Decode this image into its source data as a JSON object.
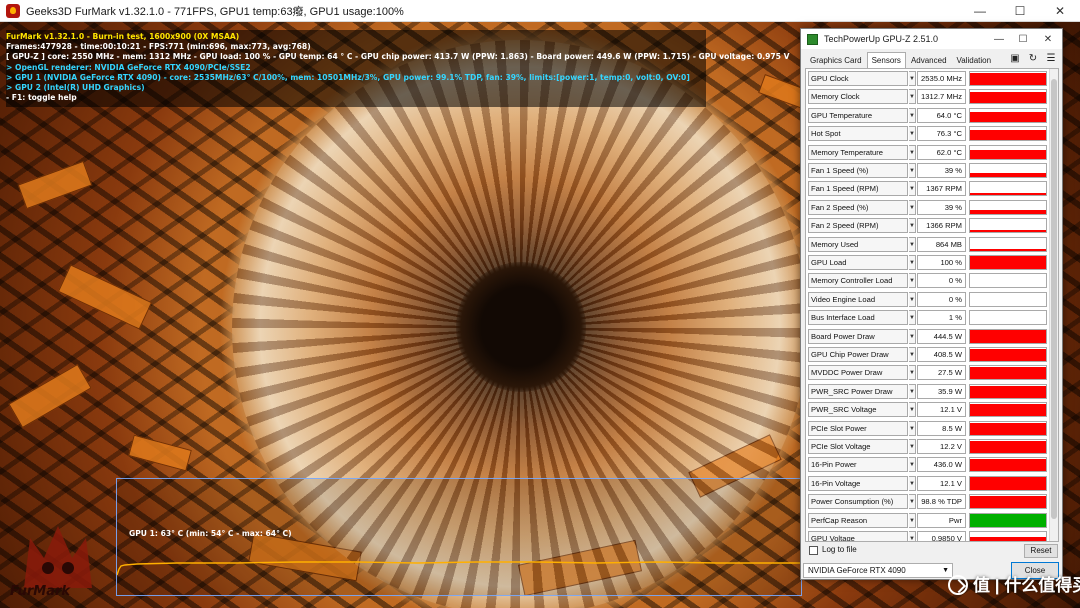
{
  "furmark_window": {
    "title": "Geeks3D FurMark v1.32.1.0 - 771FPS, GPU1 temp:63癈, GPU1 usage:100%",
    "controls": {
      "minimize": "—",
      "maximize": "☐",
      "close": "✕"
    },
    "overlay_lines": [
      {
        "text": "FurMark v1.32.1.0 - Burn-in test, 1600x900 (0X MSAA)",
        "color": "#ffe600"
      },
      {
        "text": "Frames:477928 - time:00:10:21 - FPS:771 (min:696, max:773, avg:768)",
        "color": "#ffffff"
      },
      {
        "text": "[ GPU-Z ] core: 2550 MHz - mem: 1312 MHz - GPU load: 100 % - GPU temp: 64 ° C - GPU chip power: 413.7 W (PPW: 1.863) - Board power: 449.6 W (PPW: 1.715) - GPU voltage: 0.975 V",
        "color": "#ffffff"
      },
      {
        "text": "> OpenGL renderer: NVIDIA GeForce RTX 4090/PCIe/SSE2",
        "color": "#35d6ff"
      },
      {
        "text": "> GPU 1 (NVIDIA GeForce RTX 4090) - core: 2535MHz/63° C/100%, mem: 10501MHz/3%, GPU power: 99.1% TDP, fan: 39%, limits:[power:1, temp:0, volt:0, OV:0]",
        "color": "#35d6ff"
      },
      {
        "text": "> GPU 2 (Intel(R) UHD Graphics)",
        "color": "#35d6ff"
      },
      {
        "text": "- F1: toggle help",
        "color": "#ffffff"
      }
    ],
    "temp_graph": {
      "label": "GPU 1: 63° C (min: 54° C - max: 64° C)",
      "line_color": "#ffb000"
    },
    "logo_text": "FurMark"
  },
  "gpuz_window": {
    "title": "TechPowerUp GPU-Z 2.51.0",
    "controls": {
      "minimize": "—",
      "maximize": "☐",
      "close": "✕"
    },
    "tabs": [
      "Graphics Card",
      "Sensors",
      "Advanced",
      "Validation"
    ],
    "active_tab": "Sensors",
    "sensors": [
      {
        "name": "GPU Clock",
        "value": "2535.0 MHz",
        "level": 0.95,
        "color": "#ff0000"
      },
      {
        "name": "Memory Clock",
        "value": "1312.7 MHz",
        "level": 0.9,
        "color": "#ff0000"
      },
      {
        "name": "GPU Temperature",
        "value": "64.0 °C",
        "level": 0.75,
        "color": "#ff0000"
      },
      {
        "name": "Hot Spot",
        "value": "76.3 °C",
        "level": 0.8,
        "color": "#ff0000"
      },
      {
        "name": "Memory Temperature",
        "value": "62.0 °C",
        "level": 0.65,
        "color": "#ff0000"
      },
      {
        "name": "Fan 1 Speed (%)",
        "value": "39 %",
        "level": 0.3,
        "color": "#ff0000"
      },
      {
        "name": "Fan 1 Speed (RPM)",
        "value": "1367 RPM",
        "level": 0.15,
        "color": "#ff0000"
      },
      {
        "name": "Fan 2 Speed (%)",
        "value": "39 %",
        "level": 0.3,
        "color": "#ff0000"
      },
      {
        "name": "Fan 2 Speed (RPM)",
        "value": "1366 RPM",
        "level": 0.15,
        "color": "#ff0000"
      },
      {
        "name": "Memory Used",
        "value": "864 MB",
        "level": 0.1,
        "color": "#ff0000"
      },
      {
        "name": "GPU Load",
        "value": "100 %",
        "level": 1.0,
        "color": "#ff0000"
      },
      {
        "name": "Memory Controller Load",
        "value": "0 %",
        "level": 0.0,
        "color": "#ff0000"
      },
      {
        "name": "Video Engine Load",
        "value": "0 %",
        "level": 0.0,
        "color": "#ff0000"
      },
      {
        "name": "Bus Interface Load",
        "value": "1 %",
        "level": 0.02,
        "color": "#ff0000"
      },
      {
        "name": "Board Power Draw",
        "value": "444.5 W",
        "level": 0.95,
        "color": "#ff0000"
      },
      {
        "name": "GPU Chip Power Draw",
        "value": "408.5 W",
        "level": 0.9,
        "color": "#ff0000"
      },
      {
        "name": "MVDDC Power Draw",
        "value": "27.5 W",
        "level": 0.95,
        "color": "#ff0000"
      },
      {
        "name": "PWR_SRC Power Draw",
        "value": "35.9 W",
        "level": 0.9,
        "color": "#ff0000"
      },
      {
        "name": "PWR_SRC Voltage",
        "value": "12.1 V",
        "level": 0.95,
        "color": "#ff0000"
      },
      {
        "name": "PCIe Slot Power",
        "value": "8.5 W",
        "level": 0.9,
        "color": "#ff0000"
      },
      {
        "name": "PCIe Slot Voltage",
        "value": "12.2 V",
        "level": 0.95,
        "color": "#ff0000"
      },
      {
        "name": "16-Pin Power",
        "value": "436.0 W",
        "level": 0.95,
        "color": "#ff0000"
      },
      {
        "name": "16-Pin Voltage",
        "value": "12.1 V",
        "level": 0.95,
        "color": "#ff0000"
      },
      {
        "name": "Power Consumption (%)",
        "value": "98.8 % TDP",
        "level": 0.95,
        "color": "#ff0000"
      },
      {
        "name": "PerfCap Reason",
        "value": "Pwr",
        "level": 1.0,
        "color": "#00b000"
      },
      {
        "name": "GPU Voltage",
        "value": "0.9850 V",
        "level": 0.6,
        "color": "#ff0000"
      }
    ],
    "log_to_file_label": "Log to file",
    "reset_label": "Reset",
    "gpu_select": "NVIDIA GeForce RTX 4090",
    "close_label": "Close"
  },
  "watermark": "值 | 什么值得买"
}
